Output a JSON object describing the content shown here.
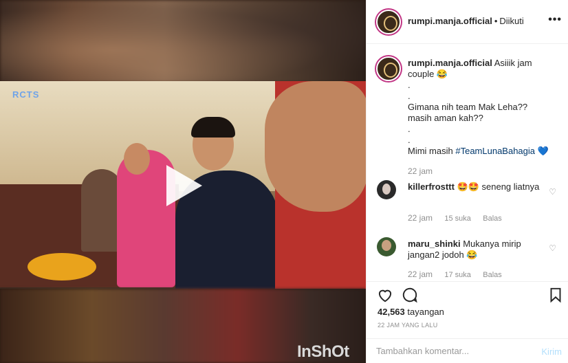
{
  "video": {
    "watermark": "RCTS",
    "watermark_sub": "",
    "inshot": "InShOt"
  },
  "header": {
    "username": "rumpi.manja.official",
    "separator": "•",
    "follow_status": "Diikuti",
    "more_label": "•••"
  },
  "caption": {
    "username": "rumpi.manja.official",
    "line1": "Asiiik jam couple 😂",
    "line2": ".",
    "line3": ".",
    "line4": "Gimana nih team Mak Leha?? masih aman kah??",
    "line5": ".",
    "line6": ".",
    "line7": "Mimi masih",
    "hashtag": "#TeamLunaBahagia",
    "heart": "💙",
    "time": "22 jam"
  },
  "comments": [
    {
      "username": "killerfrosttt",
      "text": "🤩🤩 seneng liatnya",
      "time": "22 jam",
      "likes": "15 suka",
      "reply": "Balas"
    },
    {
      "username": "maru_shinki",
      "text": "Mukanya mirip jangan2 jodoh 😂",
      "time": "22 jam",
      "likes": "17 suka",
      "reply": "Balas"
    }
  ],
  "stats": {
    "views_number": "42,563",
    "views_label": "tayangan",
    "ago": "22 JAM YANG LALU"
  },
  "add_comment": {
    "placeholder": "Tambahkan komentar...",
    "post_label": "Kirim"
  }
}
